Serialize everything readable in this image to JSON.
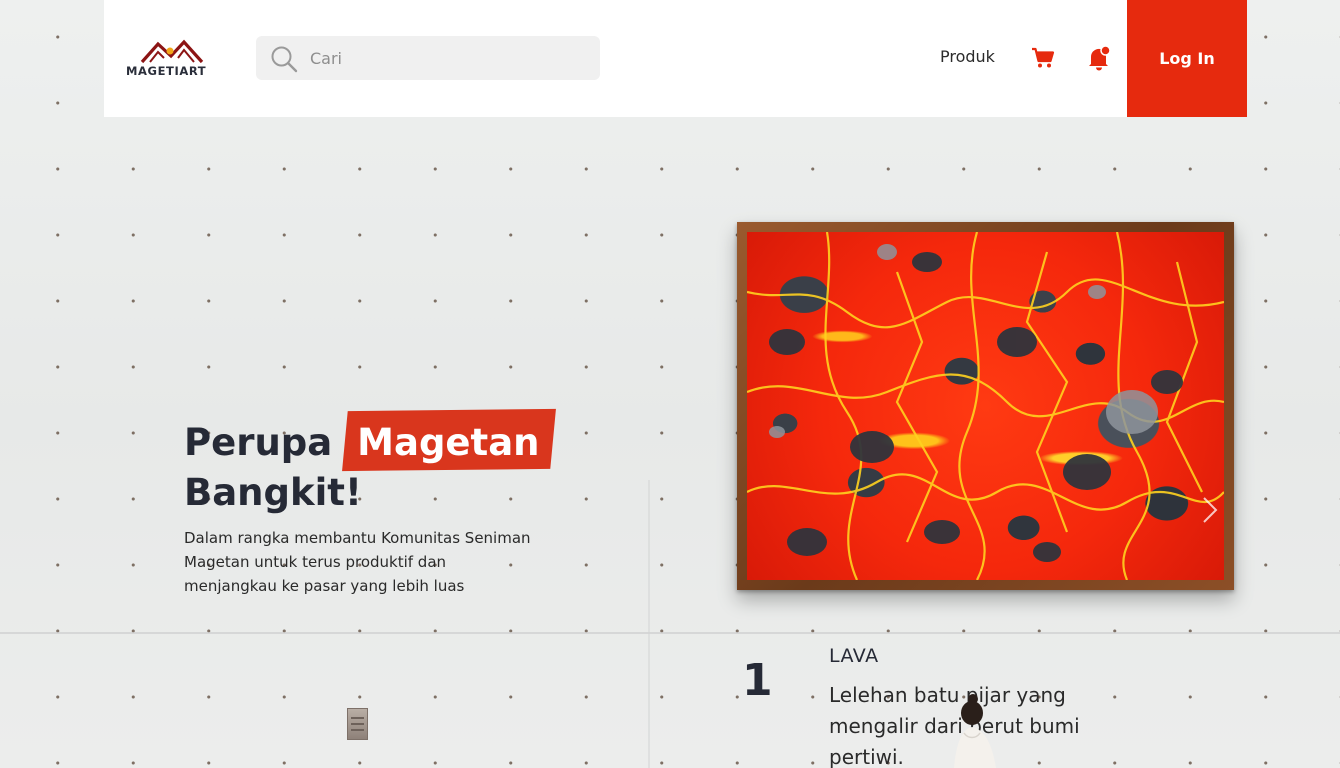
{
  "brand": {
    "name": "MAGETIART",
    "colors": {
      "accent": "#e62a0e",
      "highlight": "#d9361d",
      "dark_text": "#262a36",
      "logo_dark_red": "#8c1414",
      "logo_dot": "#f2a61a"
    }
  },
  "header": {
    "search": {
      "placeholder": "Cari",
      "value": "",
      "icon": "search-icon"
    },
    "nav": {
      "produk": "Produk"
    },
    "icons": {
      "cart": "cart-icon",
      "notification": "bell-icon"
    },
    "login_label": "Log In"
  },
  "hero": {
    "title_word1": "Perupa",
    "title_highlight": "Magetan",
    "title_line2": "Bangkit!",
    "description": "Dalam rangka membantu Komunitas Seniman Magetan untuk terus produktif dan menjangkau ke pasar yang lebih luas"
  },
  "carousel": {
    "current_number": "1",
    "next_icon": "chevron-right-icon",
    "artwork": {
      "title": "LAVA",
      "description": "Lelehan batu pijar yang mengalir dari perut bumi pertiwi."
    }
  }
}
